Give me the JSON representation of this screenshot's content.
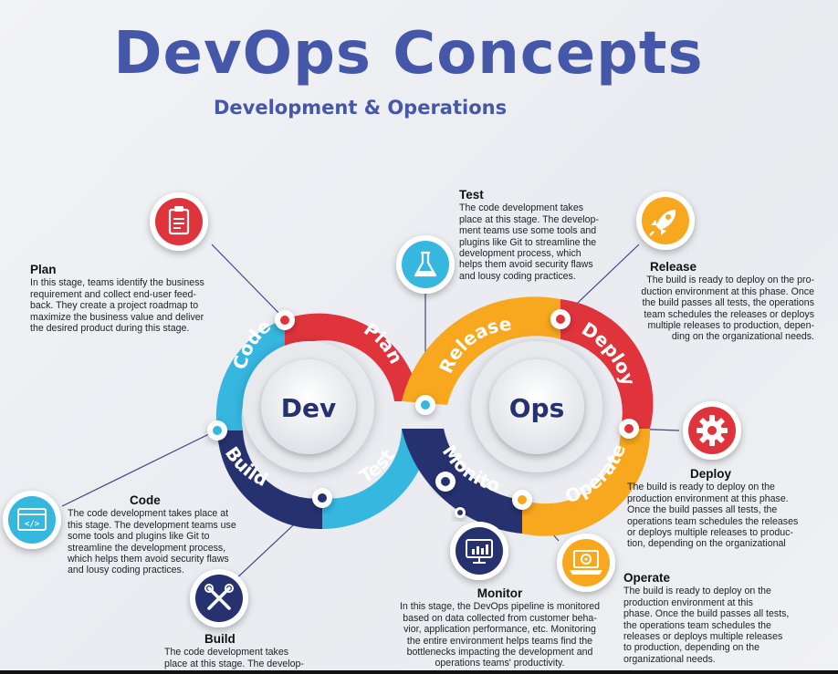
{
  "header": {
    "title": "DevOps Concepts",
    "subtitle": "Development & Operations"
  },
  "loop": {
    "center_left": "Dev",
    "center_right": "Ops",
    "segments": {
      "plan": "Plan",
      "code": "Code",
      "build": "Build",
      "test": "Test",
      "release": "Release",
      "deploy": "Deploy",
      "operate": "Operate",
      "monitor": "Monitor"
    }
  },
  "colors": {
    "title": "#4557a8",
    "plan": "#e0343c",
    "code": "#35b7e0",
    "build": "#263270",
    "test": "#35b7e0",
    "release": "#f7a81e",
    "deploy": "#e0343c",
    "operate": "#f7a81e",
    "monitor": "#263270"
  },
  "icons": {
    "plan": "clipboard-icon",
    "test": "flask-icon",
    "release": "rocket-icon",
    "deploy": "gear-icon",
    "code": "code-window-icon",
    "build": "tools-icon",
    "monitor": "monitor-chart-icon",
    "operate": "laptop-gear-icon"
  },
  "descriptions": {
    "plan": {
      "heading": "Plan",
      "lines": [
        "In this stage, teams identify the business",
        "requirement and collect end-user feed-",
        "back. They create a project roadmap to",
        "maximize the business value and deliver",
        "the desired product during this stage."
      ]
    },
    "test": {
      "heading": "Test",
      "lines": [
        "The code development takes",
        "place at this stage. The develop-",
        "ment teams use some tools and",
        "plugins like Git to streamline the",
        "development process, which",
        "helps them avoid security flaws",
        "and lousy coding practices."
      ]
    },
    "release": {
      "heading": "Release",
      "lines": [
        "The build is ready to deploy on the pro-",
        "duction environment at this phase. Once",
        "the build passes all tests, the operations",
        "team schedules the releases or deploys",
        "multiple releases to production, depen-",
        "ding on the organizational needs."
      ]
    },
    "deploy": {
      "heading": "Deploy",
      "lines": [
        "The build is ready to deploy on the",
        "production environment at this phase.",
        "Once the build passes all tests, the",
        "operations team schedules the releases",
        "or deploys multiple releases to produc-",
        "tion, depending on the organizational"
      ]
    },
    "code": {
      "heading": "Code",
      "lines": [
        "The code development takes place at",
        "this stage. The development teams use",
        "some tools and plugins like Git to",
        "streamline the development process,",
        "which helps them avoid security flaws",
        "and lousy coding practices."
      ]
    },
    "monitor": {
      "heading": "Monitor",
      "lines": [
        "In this stage, the DevOps pipeline is monitored",
        "based on data collected from customer beha-",
        "vior, application performance, etc. Monitoring",
        "the entire environment helps teams find the",
        "bottlenecks impacting the development and",
        "operations teams' productivity."
      ]
    },
    "operate": {
      "heading": "Operate",
      "lines": [
        "The build is ready to deploy on the",
        "production environment at this",
        "phase. Once the build passes all tests,",
        "the operations team schedules the",
        "releases or deploys multiple releases",
        "to production, depending on the",
        "organizational needs."
      ]
    },
    "build": {
      "heading": "Build",
      "lines": [
        "The code development takes",
        "place at this stage. The develop-"
      ]
    }
  }
}
